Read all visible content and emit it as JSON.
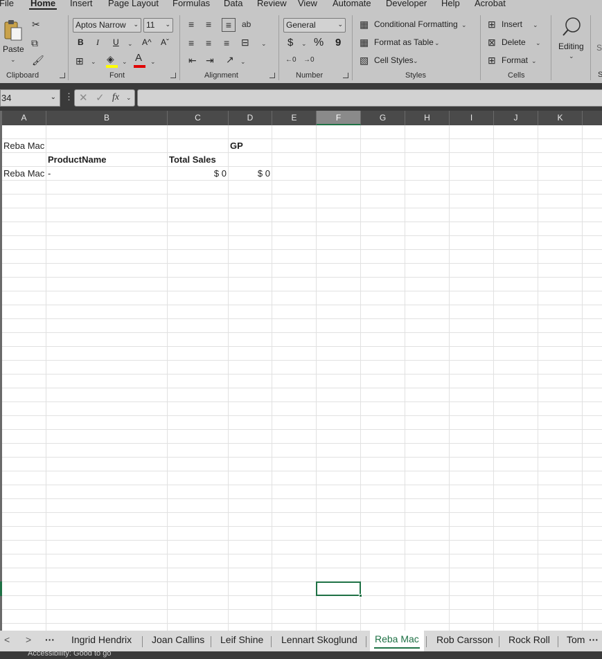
{
  "menu": {
    "tabs": [
      "File",
      "Home",
      "Insert",
      "Page Layout",
      "Formulas",
      "Data",
      "Review",
      "View",
      "Automate",
      "Developer",
      "Help",
      "Acrobat"
    ],
    "active": "Home"
  },
  "ribbon": {
    "clipboard": {
      "paste": "Paste",
      "group": "Clipboard"
    },
    "font": {
      "name": "Aptos Narrow",
      "size": "11",
      "bold": "B",
      "italic": "I",
      "underline": "U",
      "grow": "A^",
      "shrink": "Aˇ",
      "group": "Font",
      "fill_color": "#ffff00",
      "font_color": "#e00000"
    },
    "alignment": {
      "group": "Alignment"
    },
    "number": {
      "format": "General",
      "currency": "$",
      "percent": "%",
      "comma": "9",
      "group": "Number"
    },
    "styles": {
      "conditional": "Conditional Formatting",
      "table": "Format as Table",
      "cell_styles": "Cell Styles",
      "group": "Styles"
    },
    "cells": {
      "insert": "Insert",
      "delete": "Delete",
      "format": "Format",
      "group": "Cells"
    },
    "editing": {
      "label": "Editing",
      "partial_next": "S"
    }
  },
  "formula_bar": {
    "name_box": "34",
    "fx": "fx",
    "formula": ""
  },
  "columns": [
    "A",
    "B",
    "C",
    "D",
    "E",
    "F",
    "G",
    "H",
    "I",
    "J",
    "K"
  ],
  "selected_column": "F",
  "cells": {
    "a2": "Reba Mac",
    "d2": "GP",
    "b3": "ProductName",
    "c3": "Total Sales",
    "a4": "Reba Mac",
    "b4": "-",
    "c4": "$ 0",
    "d4": "$ 0"
  },
  "sheet_tabs": {
    "nav_prev": "<",
    "nav_next": ">",
    "more": "···",
    "items": [
      "Ingrid Hendrix",
      "Joan Callins",
      "Leif Shine",
      "Lennart Skoglund",
      "Reba Mac",
      "Rob Carsson",
      "Rock Roll",
      "Tom"
    ],
    "active": "Reba Mac",
    "overflow": "···"
  },
  "status": {
    "text": "Accessibility: Good to go"
  },
  "colors": {
    "accent": "#1e7145",
    "ribbon_bg": "#c6c6c6",
    "header_bg": "#4a4a4a"
  }
}
